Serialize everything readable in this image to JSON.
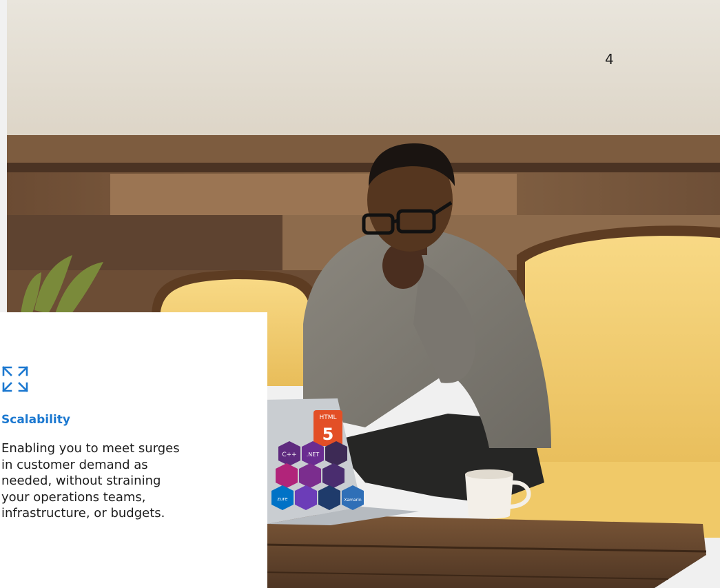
{
  "page": {
    "number": "4"
  },
  "feature": {
    "icon": "expand-arrows-icon",
    "title": "Scalability",
    "lines": [
      "Enabling you to meet surges",
      "in customer demand as",
      "needed, without straining",
      "your operations teams,",
      "infrastructure, or budgets."
    ]
  },
  "stickers": [
    "HTML",
    "5",
    "C++",
    ".NET",
    "Xamarin",
    "zure"
  ],
  "colors": {
    "accent": "#1b78d0",
    "wall": "#e7e1d6",
    "wood": "#7a5a3c",
    "sofa": "#f3cf73",
    "shirt": "#7f7b73"
  }
}
